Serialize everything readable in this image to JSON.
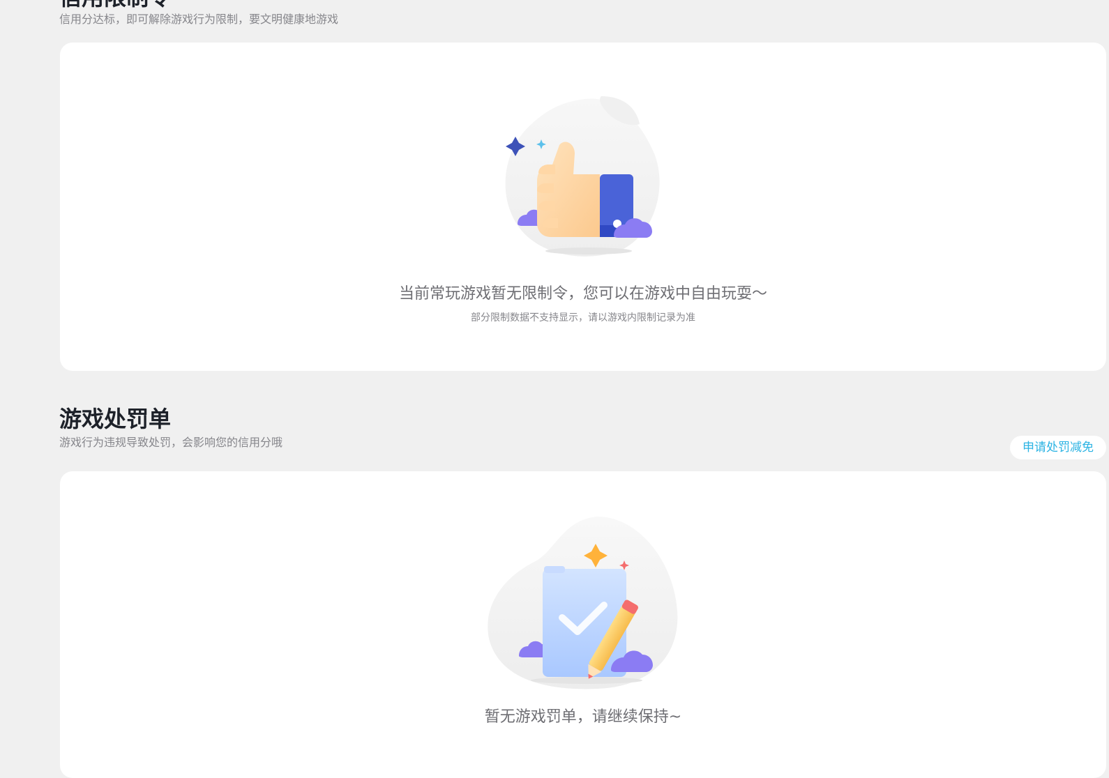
{
  "colors": {
    "page_background": "#f0f0f0",
    "card_background": "#ffffff",
    "title_text": "#1d2129",
    "subtitle_text": "#86868b",
    "accent_link": "#2bb3e3",
    "thumb_skin": "#ffd7a6",
    "cuff_blue": "#4a63d8",
    "cloud_purple": "#8b7cf3",
    "star_navy": "#3d52b8",
    "star_orange": "#ffb23a",
    "clipboard_blue": "#b9d4ff",
    "pencil_yellow": "#ffce6b"
  },
  "credit_section": {
    "title": "信用限制令",
    "subtitle": "信用分达标，即可解除游戏行为限制，要文明健康地游戏",
    "illustration_icon": "thumbs-up-icon",
    "empty_message": "当前常玩游戏暂无限制令，您可以在游戏中自由玩耍～",
    "note": "部分限制数据不支持显示，请以游戏内限制记录为准"
  },
  "penalty_section": {
    "title": "游戏处罚单",
    "subtitle": "游戏行为违规导致处罚，会影响您的信用分哦",
    "apply_button_label": "申请处罚减免",
    "illustration_icon": "clipboard-check-icon",
    "empty_message": "暂无游戏罚单，请继续保持~"
  }
}
